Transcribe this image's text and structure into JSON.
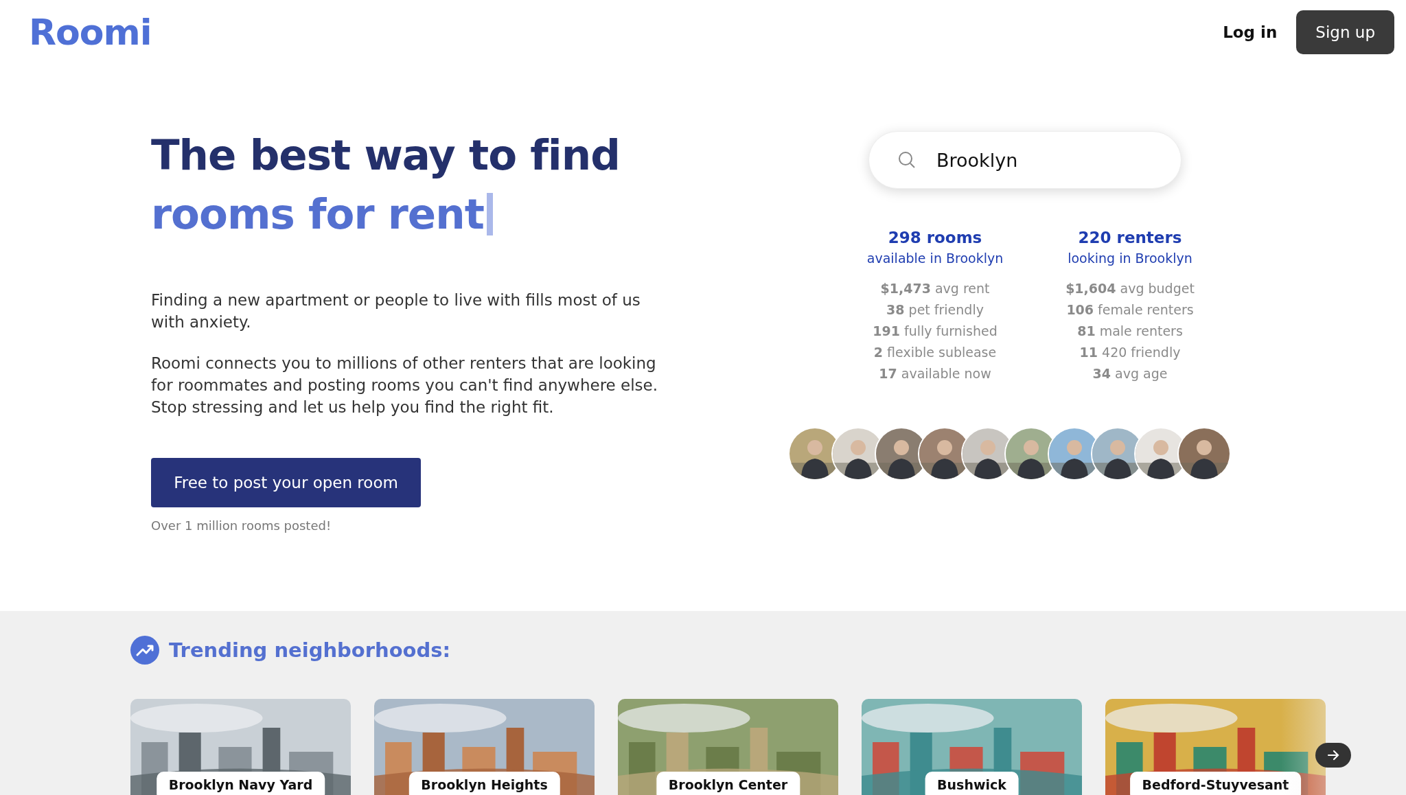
{
  "header": {
    "logo": "Roomi",
    "login": "Log in",
    "signup": "Sign up"
  },
  "hero": {
    "title_line1": "The best way to find",
    "title_line2": "rooms for rent",
    "paragraphs": [
      "Finding a new apartment or people to live with fills most of us with anxiety.",
      "Roomi connects you to millions of other renters that are looking for roommates and posting rooms you can't find anywhere else. Stop stressing and let us help you find the right fit."
    ],
    "cta": "Free to post your open room",
    "note": "Over 1 million rooms posted!"
  },
  "search": {
    "value": "Brooklyn"
  },
  "stats": [
    {
      "headline": "298 rooms",
      "sub": "available in Brooklyn",
      "rows": [
        "**$1,473** avg rent",
        "**38** pet friendly",
        "**191** fully furnished",
        "**2** flexible sublease",
        "**17** available now"
      ]
    },
    {
      "headline": "220 renters",
      "sub": "looking in Brooklyn",
      "rows": [
        "**$1,604** avg budget",
        "**106** female renters",
        "**81** male renters",
        "**11** 420 friendly",
        "**34** avg age"
      ]
    }
  ],
  "trending": {
    "title": "Trending neighborhoods:",
    "cards": [
      {
        "name": "Brooklyn Navy Yard",
        "kind": "picture"
      },
      {
        "name": "Brooklyn Heights",
        "kind": "picture"
      },
      {
        "name": "Brooklyn Center",
        "kind": "picture"
      },
      {
        "name": "Bushwick",
        "kind": "picture"
      },
      {
        "name": "Bedford-Stuyvesant",
        "kind": "picture"
      }
    ]
  }
}
